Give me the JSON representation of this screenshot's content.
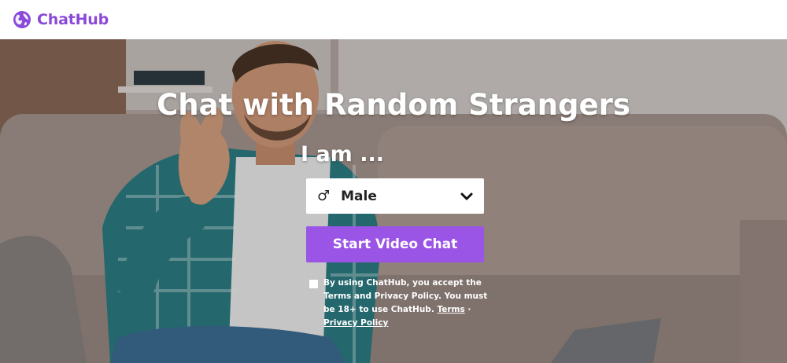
{
  "header": {
    "brand_name": "ChatHub",
    "brand_color": "#8a49d8",
    "logo_icon": "globe-icon"
  },
  "hero": {
    "title": "Chat with Random Strangers",
    "iam_label": "I am ...",
    "gender_select": {
      "icon": "male-symbol-icon",
      "symbol": "♂",
      "value": "Male",
      "chevron_icon": "chevron-down-icon"
    },
    "start_button_label": "Start Video Chat",
    "accent_color": "#9a54e6",
    "terms": {
      "text": "By using ChatHub, you accept the Terms and Privacy Policy. You must be 18+ to use ChatHub.",
      "terms_link": "Terms",
      "separator": " · ",
      "privacy_link": "Privacy Policy"
    }
  }
}
